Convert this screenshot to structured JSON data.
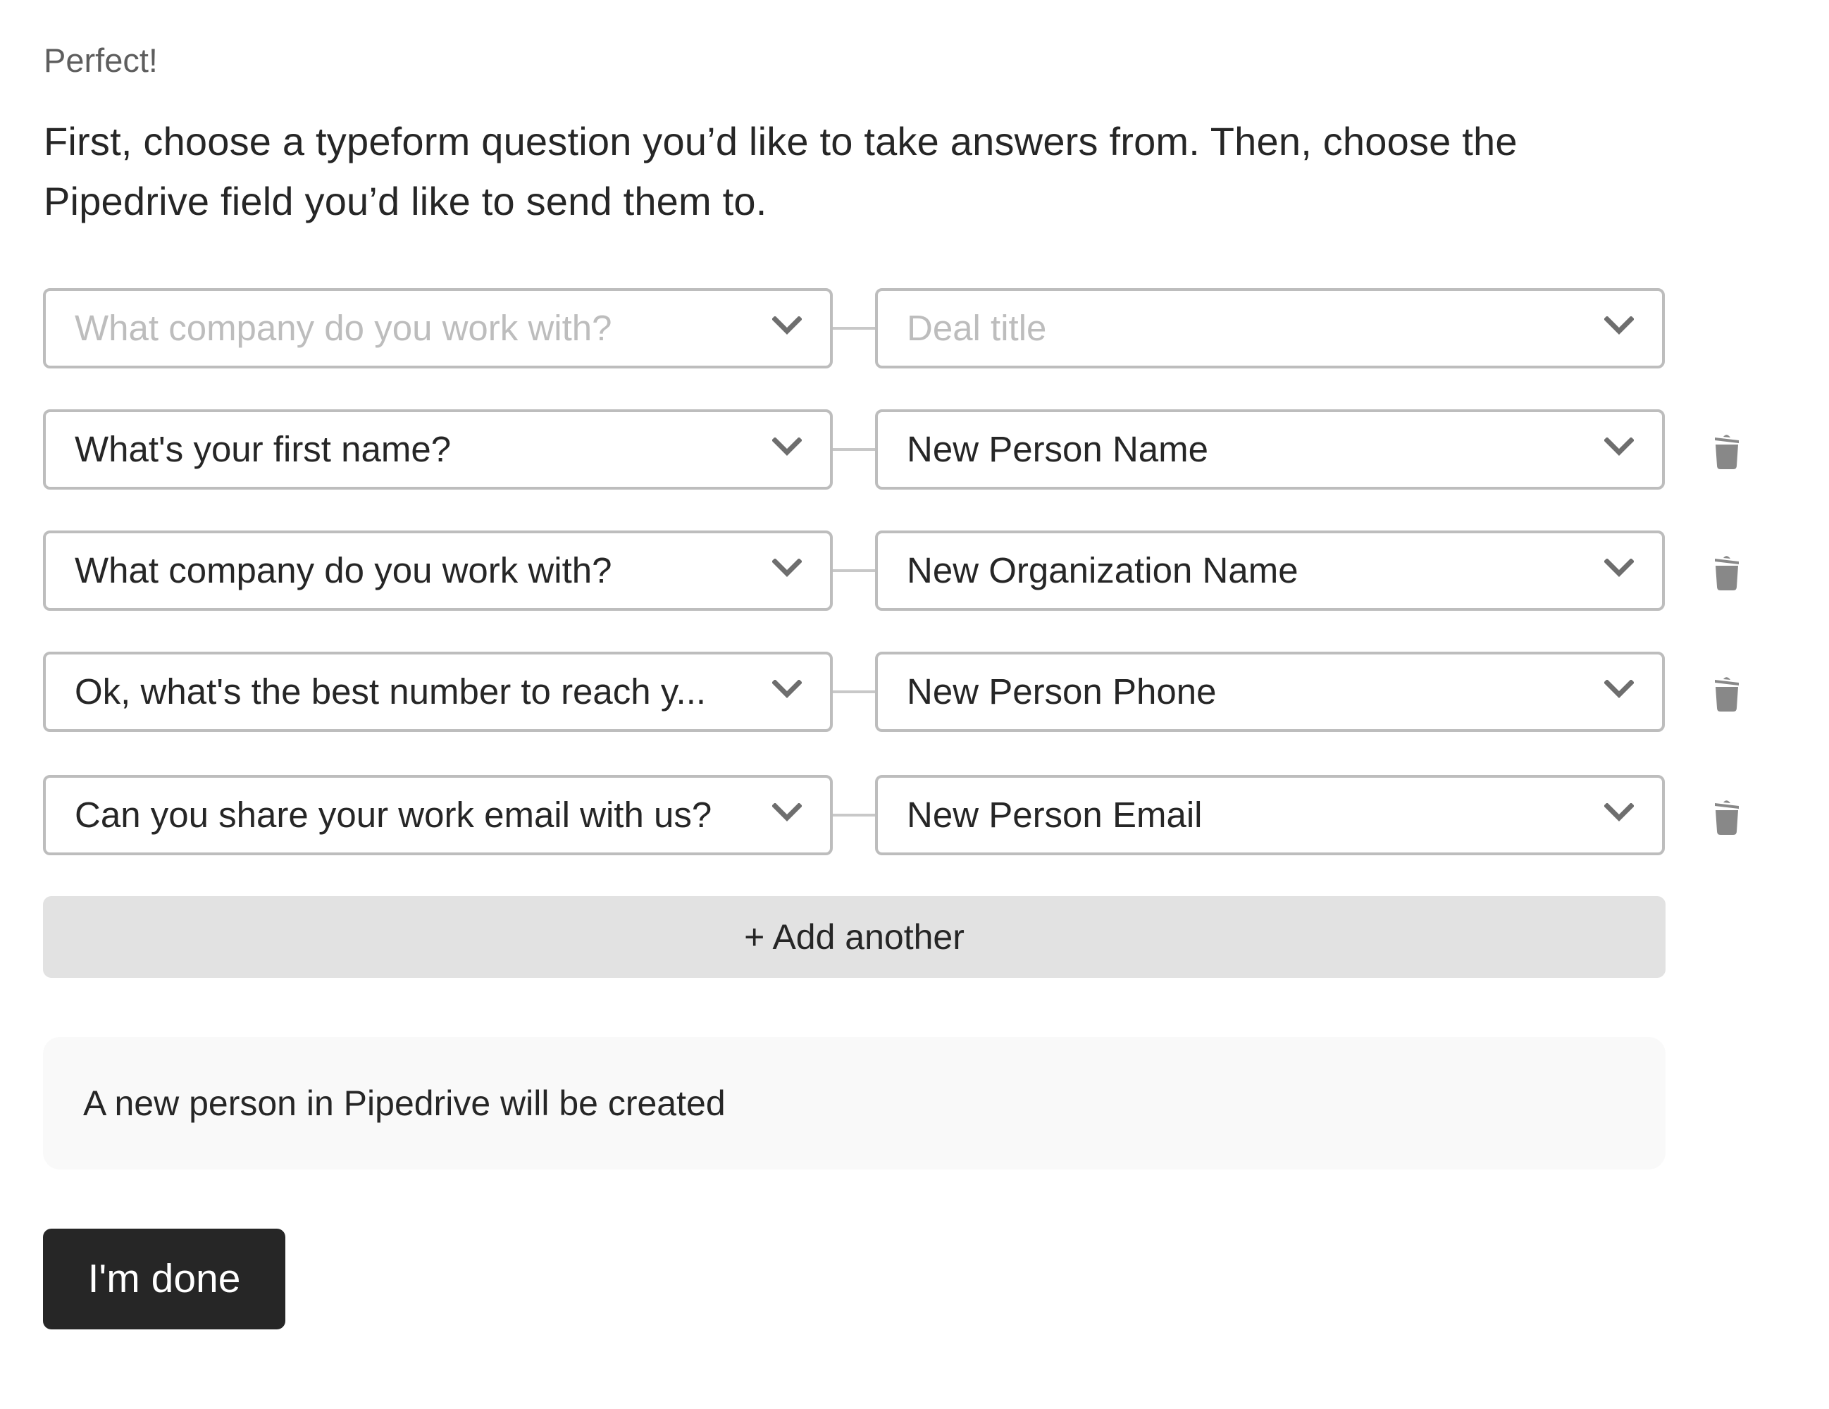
{
  "header": {
    "label": "Perfect!",
    "instructions": "First, choose a typeform question you’d like to take answers from. Then, choose the Pipedrive field you’d like to send them to."
  },
  "mappings": [
    {
      "question": {
        "value": "",
        "placeholder": "What company do you work with?"
      },
      "field": {
        "value": "",
        "placeholder": "Deal title"
      },
      "deletable": false
    },
    {
      "question": {
        "value": "What's your first name?"
      },
      "field": {
        "value": "New Person Name"
      },
      "deletable": true
    },
    {
      "question": {
        "value": "What company do you work with?"
      },
      "field": {
        "value": "New Organization Name"
      },
      "deletable": true
    },
    {
      "question": {
        "value": "Ok, what's the best number to reach y..."
      },
      "field": {
        "value": "New Person Phone"
      },
      "deletable": true
    },
    {
      "question": {
        "value": "Can you share your work email with us?"
      },
      "field": {
        "value": "New Person Email"
      },
      "deletable": true
    }
  ],
  "icons": {
    "dropdown": "chevron-down-icon",
    "delete": "trash-icon"
  },
  "actions": {
    "add_another_label": "+ Add another",
    "done_label": "I'm done"
  },
  "info": {
    "message": "A new person in Pipedrive will be created"
  },
  "colors": {
    "text": "#262626",
    "muted_text": "#5e5e5e",
    "placeholder": "#bdbdbd",
    "border": "#bdbdbd",
    "icon": "#6e6e6e",
    "trash": "#888888",
    "add_button_bg": "#e2e2e2",
    "info_bg": "#f9f9f9",
    "primary_button_bg": "#262626",
    "primary_button_text": "#ffffff"
  }
}
